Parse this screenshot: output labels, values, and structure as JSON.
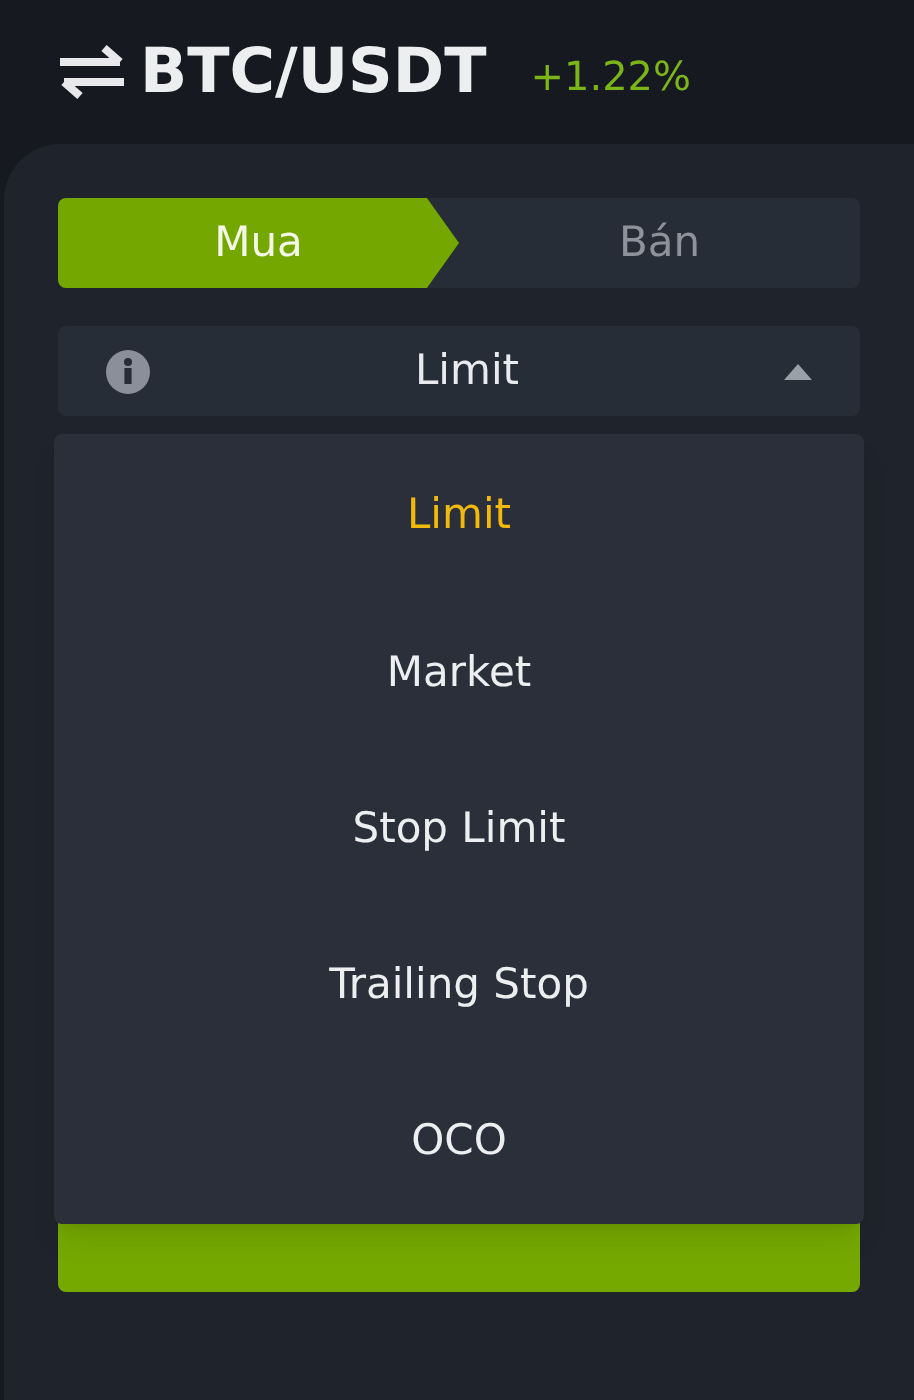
{
  "header": {
    "pair": "BTC/USDT",
    "change": "+1.22%"
  },
  "tabs": [
    {
      "label": "Mua",
      "selected": true
    },
    {
      "label": "Bán",
      "selected": false
    }
  ],
  "order_type": {
    "value": "Limit",
    "expanded": true
  },
  "dropdown": [
    {
      "label": "Limit",
      "selected": true
    },
    {
      "label": "Market",
      "selected": false
    },
    {
      "label": "Stop Limit",
      "selected": false
    },
    {
      "label": "Trailing Stop",
      "selected": false
    },
    {
      "label": "OCO",
      "selected": false
    }
  ]
}
